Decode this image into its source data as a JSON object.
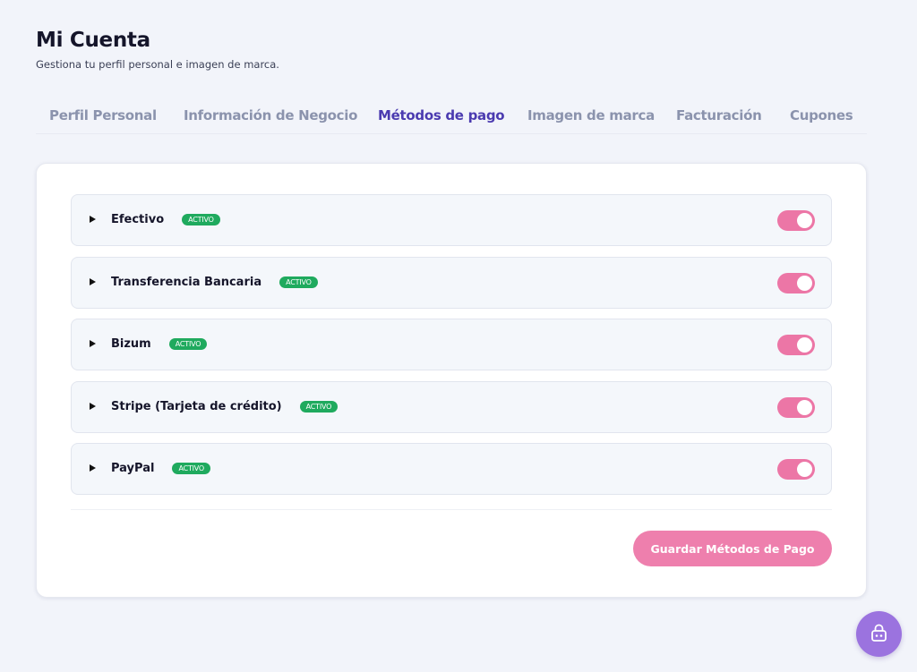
{
  "header": {
    "title": "Mi Cuenta",
    "subtitle": "Gestiona tu perfil personal e imagen de marca."
  },
  "tabs": [
    {
      "label": "Perfil Personal",
      "active": false
    },
    {
      "label": "Información de Negocio",
      "active": false
    },
    {
      "label": "Métodos de pago",
      "active": true
    },
    {
      "label": "Imagen de marca",
      "active": false
    },
    {
      "label": "Facturación",
      "active": false
    },
    {
      "label": "Cupones",
      "active": false
    }
  ],
  "methods": [
    {
      "name": "Efectivo",
      "badge": "ACTIVO",
      "enabled": true
    },
    {
      "name": "Transferencia Bancaria",
      "badge": "ACTIVO",
      "enabled": true
    },
    {
      "name": "Bizum",
      "badge": "ACTIVO",
      "enabled": true
    },
    {
      "name": "Stripe (Tarjeta de crédito)",
      "badge": "ACTIVO",
      "enabled": true
    },
    {
      "name": "PayPal",
      "badge": "ACTIVO",
      "enabled": true
    }
  ],
  "actions": {
    "save_label": "Guardar Métodos de Pago"
  },
  "floating_button": {
    "icon": "robot-icon"
  },
  "colors": {
    "accent_tab": "#4b3bb0",
    "toggle_on": "#ec76a6",
    "badge": "#1faa5e",
    "save_button": "#ee7fad",
    "fab": "#9b73df"
  }
}
